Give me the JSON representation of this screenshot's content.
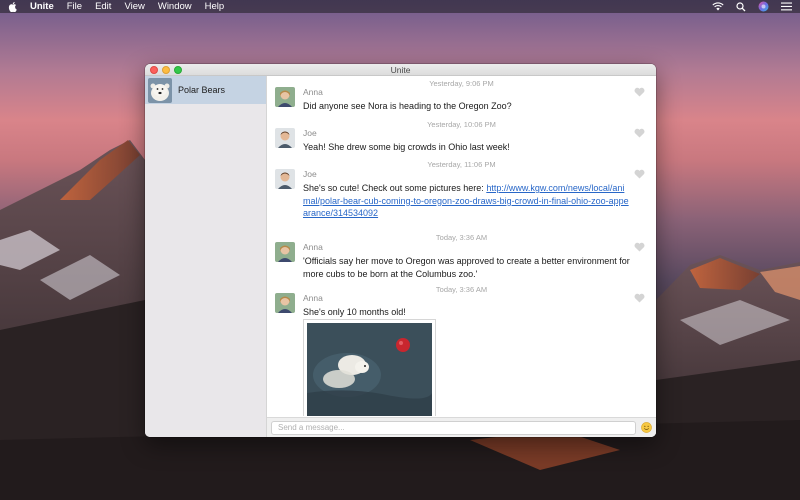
{
  "menubar": {
    "app_name": "Unite",
    "menus": [
      "File",
      "Edit",
      "View",
      "Window",
      "Help"
    ],
    "icons": [
      "apple-icon",
      "wifi-icon",
      "search-icon",
      "siri-icon",
      "list-icon"
    ]
  },
  "window": {
    "title": "Unite"
  },
  "sidebar": {
    "conversations": [
      {
        "name": "Polar Bears",
        "selected": true
      }
    ]
  },
  "messages": [
    {
      "timestamp": "Yesterday, 9:06 PM",
      "sender": "Anna",
      "text": "Did anyone see Nora is heading to the Oregon Zoo?"
    },
    {
      "timestamp": "Yesterday, 10:06 PM",
      "sender": "Joe",
      "text": "Yeah! She drew some big crowds in Ohio last week!"
    },
    {
      "timestamp": "Yesterday, 11:06 PM",
      "sender": "Joe",
      "text": "She's so cute! Check out some pictures here: ",
      "link": "http://www.kgw.com/news/local/animal/polar-bear-cub-coming-to-oregon-zoo-draws-big-crowd-in-final-ohio-zoo-appearance/314534092"
    },
    {
      "timestamp": "Today, 3:36 AM",
      "sender": "Anna",
      "text": "'Officials say her move to Oregon was approved to create a better environment for more cubs to be born at the Columbus zoo.'"
    },
    {
      "timestamp": "Today, 3:36 AM",
      "sender": "Anna",
      "text": "She's only 10 months old!",
      "attachment": "photo"
    }
  ],
  "composer": {
    "placeholder": "Send a message..."
  },
  "colors": {
    "accent_link": "#2867c8",
    "selection": "#c5d3e3",
    "close": "#fc605c",
    "minimize": "#fdbc40",
    "maximize": "#34c84a"
  }
}
